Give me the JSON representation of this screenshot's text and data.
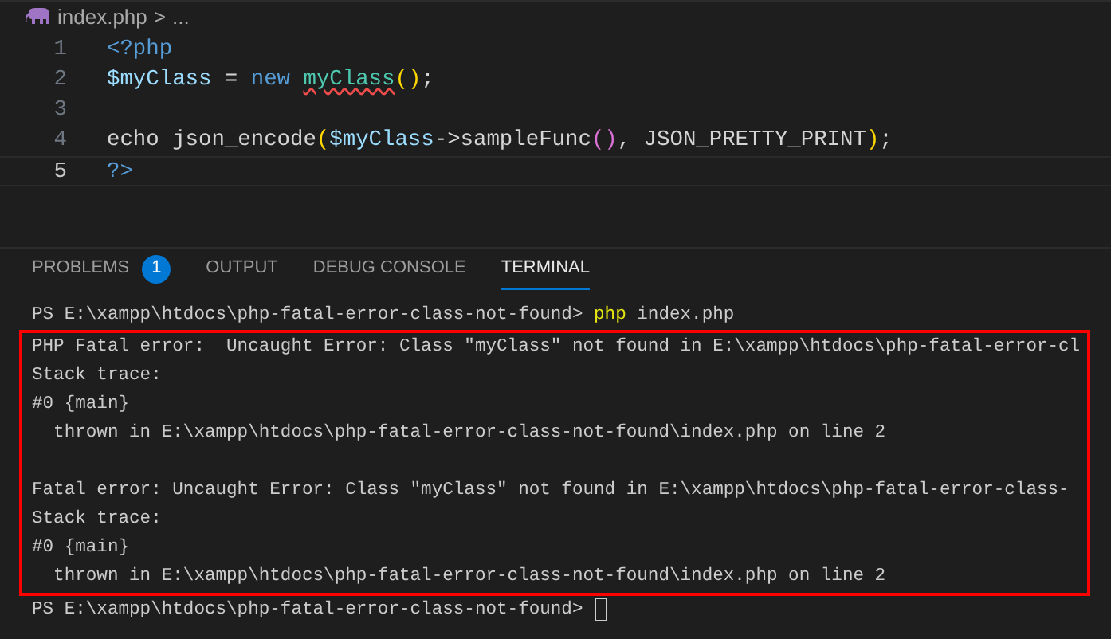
{
  "breadcrumb": {
    "file": "index.php",
    "separator": ">",
    "more": "..."
  },
  "editor": {
    "lines": [
      {
        "number": "1",
        "current": false,
        "tokens": [
          {
            "text": "<?php",
            "kind": "keyword"
          }
        ]
      },
      {
        "number": "2",
        "current": false,
        "tokens": [
          {
            "text": "$myClass",
            "kind": "variable"
          },
          {
            "text": " = ",
            "kind": "plain"
          },
          {
            "text": "new ",
            "kind": "keyword"
          },
          {
            "text": "myClass",
            "kind": "class",
            "squiggle": true
          },
          {
            "text": "()",
            "kind": "bracket"
          },
          {
            "text": ";",
            "kind": "plain"
          }
        ]
      },
      {
        "number": "3",
        "current": false
      },
      {
        "number": "4",
        "current": false,
        "tokens": [
          {
            "text": "echo json_encode",
            "kind": "plain"
          },
          {
            "text": "(",
            "kind": "bracket"
          },
          {
            "text": "$myClass",
            "kind": "variable"
          },
          {
            "text": "->sampleFunc",
            "kind": "plain"
          },
          {
            "text": "()",
            "kind": "bracket2"
          },
          {
            "text": ", JSON_PRETTY_PRINT",
            "kind": "plain"
          },
          {
            "text": ")",
            "kind": "bracket"
          },
          {
            "text": ";",
            "kind": "plain"
          }
        ]
      },
      {
        "number": "5",
        "current": true,
        "tokens": [
          {
            "text": "?>",
            "kind": "keyword"
          }
        ]
      }
    ]
  },
  "panel": {
    "tabs": [
      {
        "label": "PROBLEMS",
        "selected": false,
        "badge": "1"
      },
      {
        "label": "OUTPUT",
        "selected": false
      },
      {
        "label": "DEBUG CONSOLE",
        "selected": false
      },
      {
        "label": "TERMINAL",
        "selected": true
      }
    ]
  },
  "terminal": {
    "prompt": {
      "path": "PS E:\\xampp\\htdocs\\php-fatal-error-class-not-found> ",
      "command": "php",
      "args": " index.php"
    },
    "highlighted_output": [
      [
        "PHP Fatal error:  Uncaught Error: Class \"myClass\" not found in E:\\xampp\\htdocs\\php-fatal-error-cl",
        "Stack trace:",
        "#0 {main}",
        "  thrown in E:\\xampp\\htdocs\\php-fatal-error-class-not-found\\index.php on line 2"
      ],
      [
        "Fatal error: Uncaught Error: Class \"myClass\" not found in E:\\xampp\\htdocs\\php-fatal-error-class-",
        "Stack trace:",
        "#0 {main}",
        "  thrown in E:\\xampp\\htdocs\\php-fatal-error-class-not-found\\index.php on line 2"
      ]
    ],
    "final_prompt": "PS E:\\xampp\\htdocs\\php-fatal-error-class-not-found> "
  }
}
